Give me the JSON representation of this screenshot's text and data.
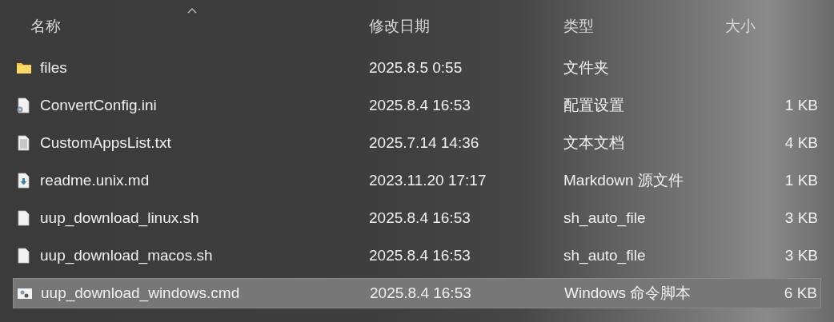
{
  "columns": [
    {
      "label": "名称",
      "sorted": true
    },
    {
      "label": "修改日期",
      "sorted": false
    },
    {
      "label": "类型",
      "sorted": false
    },
    {
      "label": "大小",
      "sorted": false
    }
  ],
  "rows": [
    {
      "kind": "folder",
      "name": "files",
      "date": "2025.8.5 0:55",
      "type": "文件夹",
      "selected": false
    },
    {
      "kind": "config",
      "name": "ConvertConfig.ini",
      "date": "2025.8.4 16:53",
      "type": "配置设置",
      "size": "1 KB",
      "selected": false
    },
    {
      "kind": "text",
      "name": "CustomAppsList.txt",
      "date": "2025.7.14 14:36",
      "type": "文本文档",
      "size": "4 KB",
      "selected": false
    },
    {
      "kind": "markdown",
      "name": "readme.unix.md",
      "date": "2023.11.20 17:17",
      "type": "Markdown 源文件",
      "size": "1 KB",
      "selected": false
    },
    {
      "kind": "blank",
      "name": "uup_download_linux.sh",
      "date": "2025.8.4 16:53",
      "type": "sh_auto_file",
      "size": "3 KB",
      "selected": false
    },
    {
      "kind": "blank",
      "name": "uup_download_macos.sh",
      "date": "2025.8.4 16:53",
      "type": "sh_auto_file",
      "size": "3 KB",
      "selected": false
    },
    {
      "kind": "script",
      "name": "uup_download_windows.cmd",
      "date": "2025.8.4 16:53",
      "type": "Windows 命令脚本",
      "size": "6 KB",
      "selected": true
    }
  ]
}
